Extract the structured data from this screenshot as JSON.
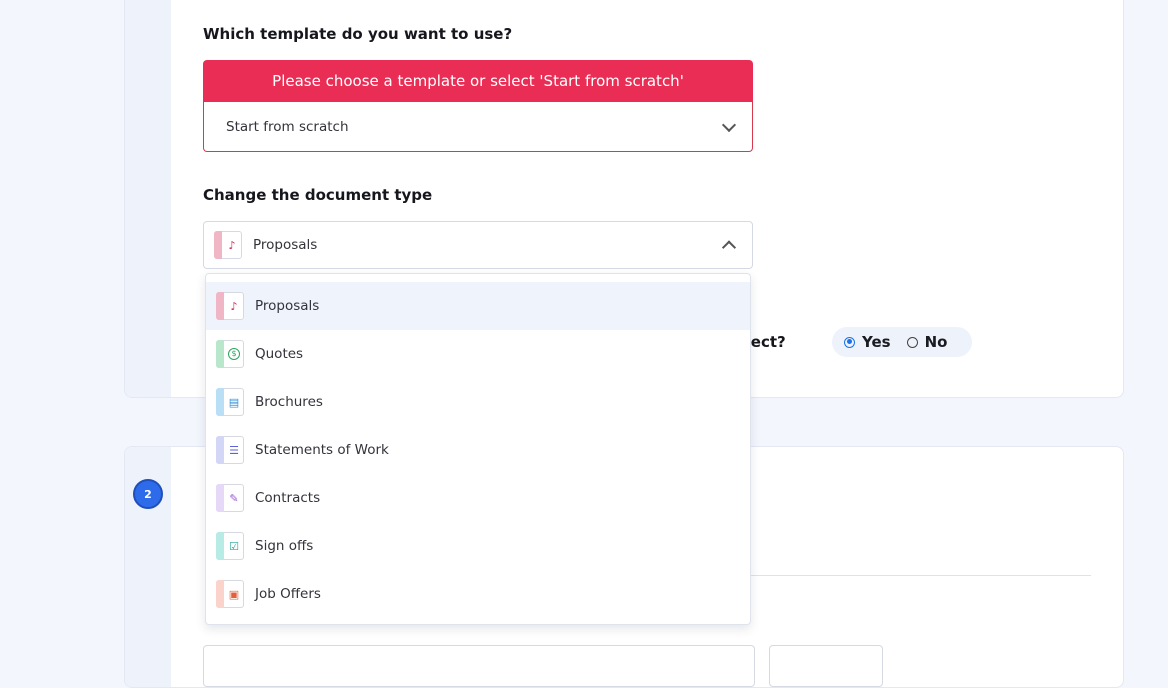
{
  "template_section": {
    "question": "Which template do you want to use?",
    "error": "Please choose a template or select 'Start from scratch'",
    "selected": "Start from scratch"
  },
  "doctype_section": {
    "question": "Change the document type",
    "selected": "Proposals",
    "options": [
      {
        "label": "Proposals",
        "icon": "signature-icon",
        "color": "#e8a0b4",
        "glyph_color": "#d3264d"
      },
      {
        "label": "Quotes",
        "icon": "dollar-icon",
        "color": "#9ad9b3",
        "glyph_color": "#2aa65e"
      },
      {
        "label": "Brochures",
        "icon": "brochure-icon",
        "color": "#9ccff2",
        "glyph_color": "#2c8fd8"
      },
      {
        "label": "Statements of Work",
        "icon": "checklist-icon",
        "color": "#c3c8f0",
        "glyph_color": "#5b63d6"
      },
      {
        "label": "Contracts",
        "icon": "contract-icon",
        "color": "#dbc7f2",
        "glyph_color": "#9a59d6"
      },
      {
        "label": "Sign offs",
        "icon": "signoff-icon",
        "color": "#97e0da",
        "glyph_color": "#21a99c"
      },
      {
        "label": "Job Offers",
        "icon": "briefcase-icon",
        "color": "#f7c0b5",
        "glyph_color": "#e4603d"
      }
    ]
  },
  "confirm": {
    "question_fragment": "rrect?",
    "yes": "Yes",
    "no": "No",
    "selected": "Yes"
  },
  "step2": {
    "number": "2"
  }
}
